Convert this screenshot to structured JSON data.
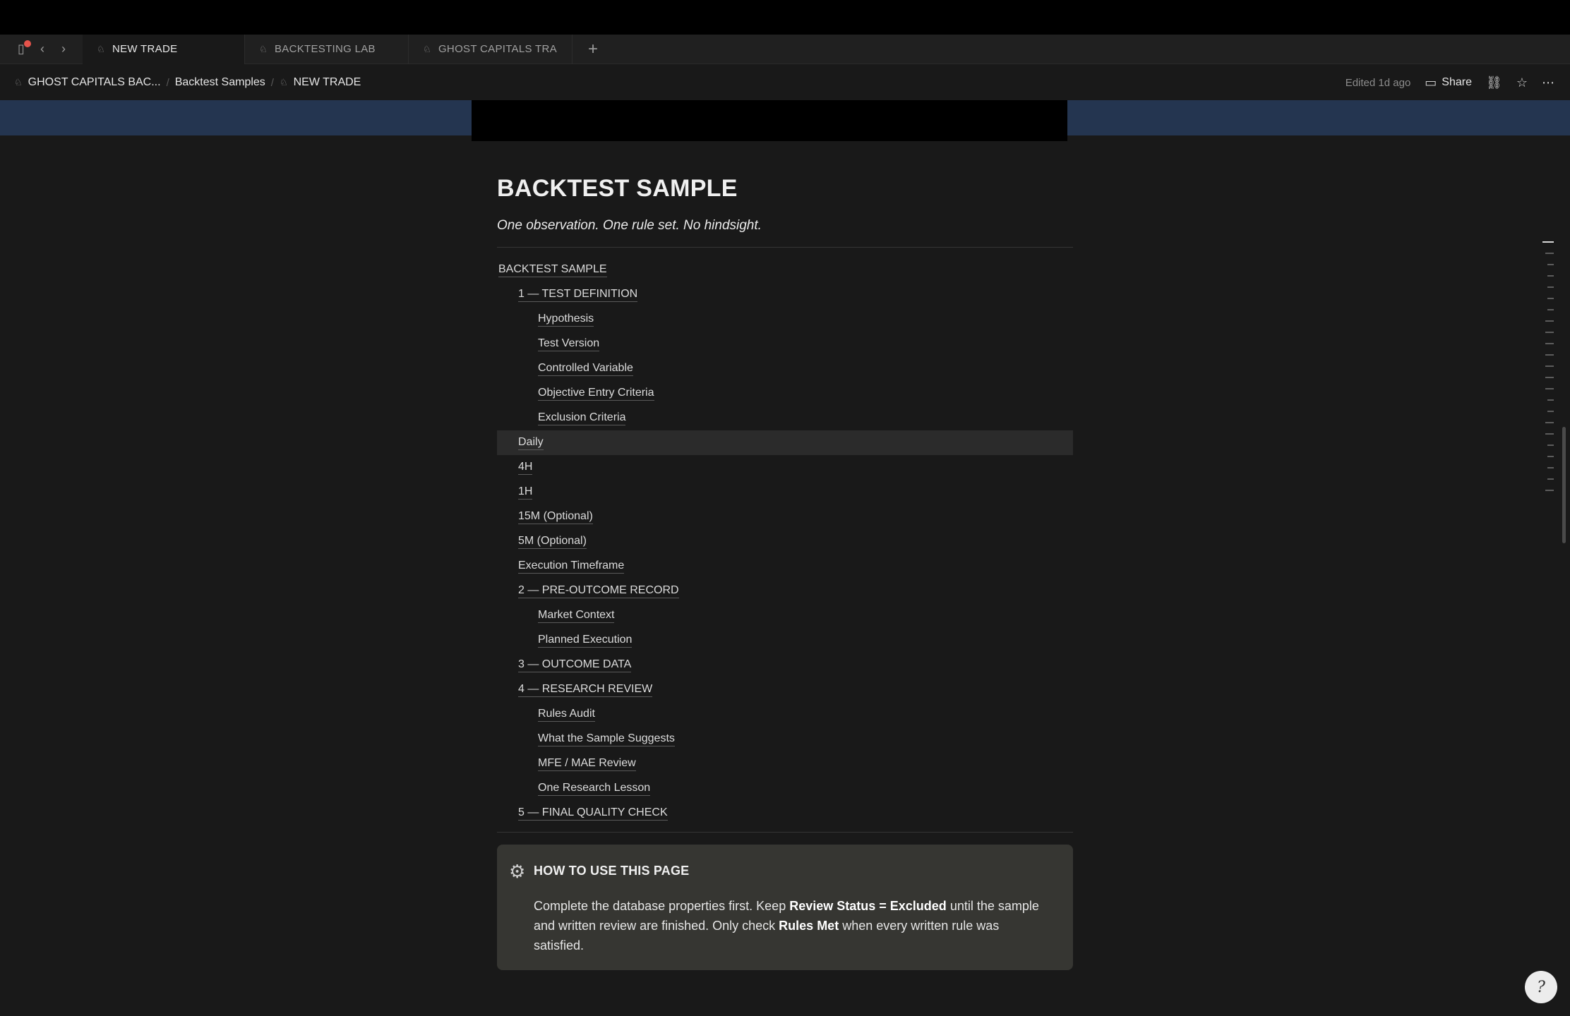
{
  "tabs": [
    {
      "label": "NEW TRADE",
      "active": true
    },
    {
      "label": "BACKTESTING LAB",
      "active": false
    },
    {
      "label": "GHOST CAPITALS TRA",
      "active": false
    }
  ],
  "icons": {
    "sidebar": "▯",
    "back": "‹",
    "forward": "›",
    "page": "♘",
    "new_tab": "+",
    "share": "▭",
    "link": "⛓",
    "star": "☆",
    "more": "⋯",
    "gear": "⚙",
    "help": "?"
  },
  "breadcrumb": [
    "GHOST CAPITALS BAC...",
    "Backtest Samples",
    "NEW TRADE"
  ],
  "toolbar": {
    "edited": "Edited 1d ago",
    "share": "Share"
  },
  "page": {
    "title": "BACKTEST SAMPLE",
    "subtitle": "One observation. One rule set. No hindsight."
  },
  "toc": [
    {
      "label": "BACKTEST SAMPLE",
      "level": 0
    },
    {
      "label": "1 — TEST DEFINITION",
      "level": 1
    },
    {
      "label": "Hypothesis",
      "level": 2
    },
    {
      "label": "Test Version",
      "level": 2
    },
    {
      "label": "Controlled Variable",
      "level": 2
    },
    {
      "label": "Objective Entry Criteria",
      "level": 2
    },
    {
      "label": "Exclusion Criteria",
      "level": 2
    },
    {
      "label": "Daily",
      "level": 1
    },
    {
      "label": "4H",
      "level": 1
    },
    {
      "label": "1H",
      "level": 1
    },
    {
      "label": "15M (Optional)",
      "level": 1
    },
    {
      "label": "5M (Optional)",
      "level": 1
    },
    {
      "label": "Execution Timeframe",
      "level": 1
    },
    {
      "label": "2 — PRE-OUTCOME RECORD",
      "level": 1
    },
    {
      "label": "Market Context",
      "level": 2
    },
    {
      "label": "Planned Execution",
      "level": 2
    },
    {
      "label": "3 — OUTCOME DATA",
      "level": 1
    },
    {
      "label": "4 — RESEARCH REVIEW",
      "level": 1
    },
    {
      "label": "Rules Audit",
      "level": 2
    },
    {
      "label": "What the Sample Suggests",
      "level": 2
    },
    {
      "label": "MFE / MAE Review",
      "level": 2
    },
    {
      "label": "One Research Lesson",
      "level": 2
    },
    {
      "label": "5 — FINAL QUALITY CHECK",
      "level": 1
    }
  ],
  "callout": {
    "title": "HOW TO USE THIS PAGE",
    "body_parts": [
      {
        "text": "Complete the database properties first. Keep ",
        "bold": false
      },
      {
        "text": "Review Status = Excluded",
        "bold": true
      },
      {
        "text": " until the sample and written review are finished. Only check ",
        "bold": false
      },
      {
        "text": "Rules Met",
        "bold": true
      },
      {
        "text": " when every written rule was satisfied.",
        "bold": false
      }
    ]
  }
}
